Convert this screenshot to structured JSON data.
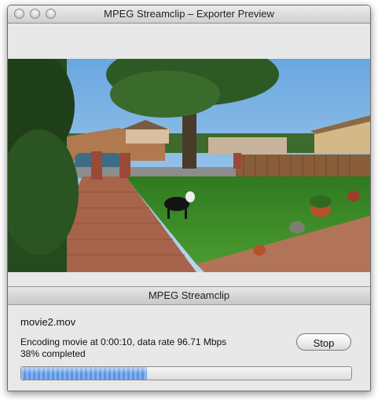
{
  "window": {
    "title": "MPEG Streamclip – Exporter Preview"
  },
  "icons": {
    "close": "close-button",
    "minimize": "minimize-button",
    "zoom": "zoom-button"
  },
  "progress_sheet": {
    "title": "MPEG Streamclip",
    "file_name": "movie2.mov",
    "status": "Encoding movie at 0:00:10, data rate 96.71 Mbps",
    "percent_text": "38% completed",
    "progress_fraction": 0.38,
    "stop_label": "Stop"
  },
  "colors": {
    "progress_fill": "#5b93e0",
    "sky": "#8fc0e8",
    "lawn": "#3f8a2a"
  }
}
